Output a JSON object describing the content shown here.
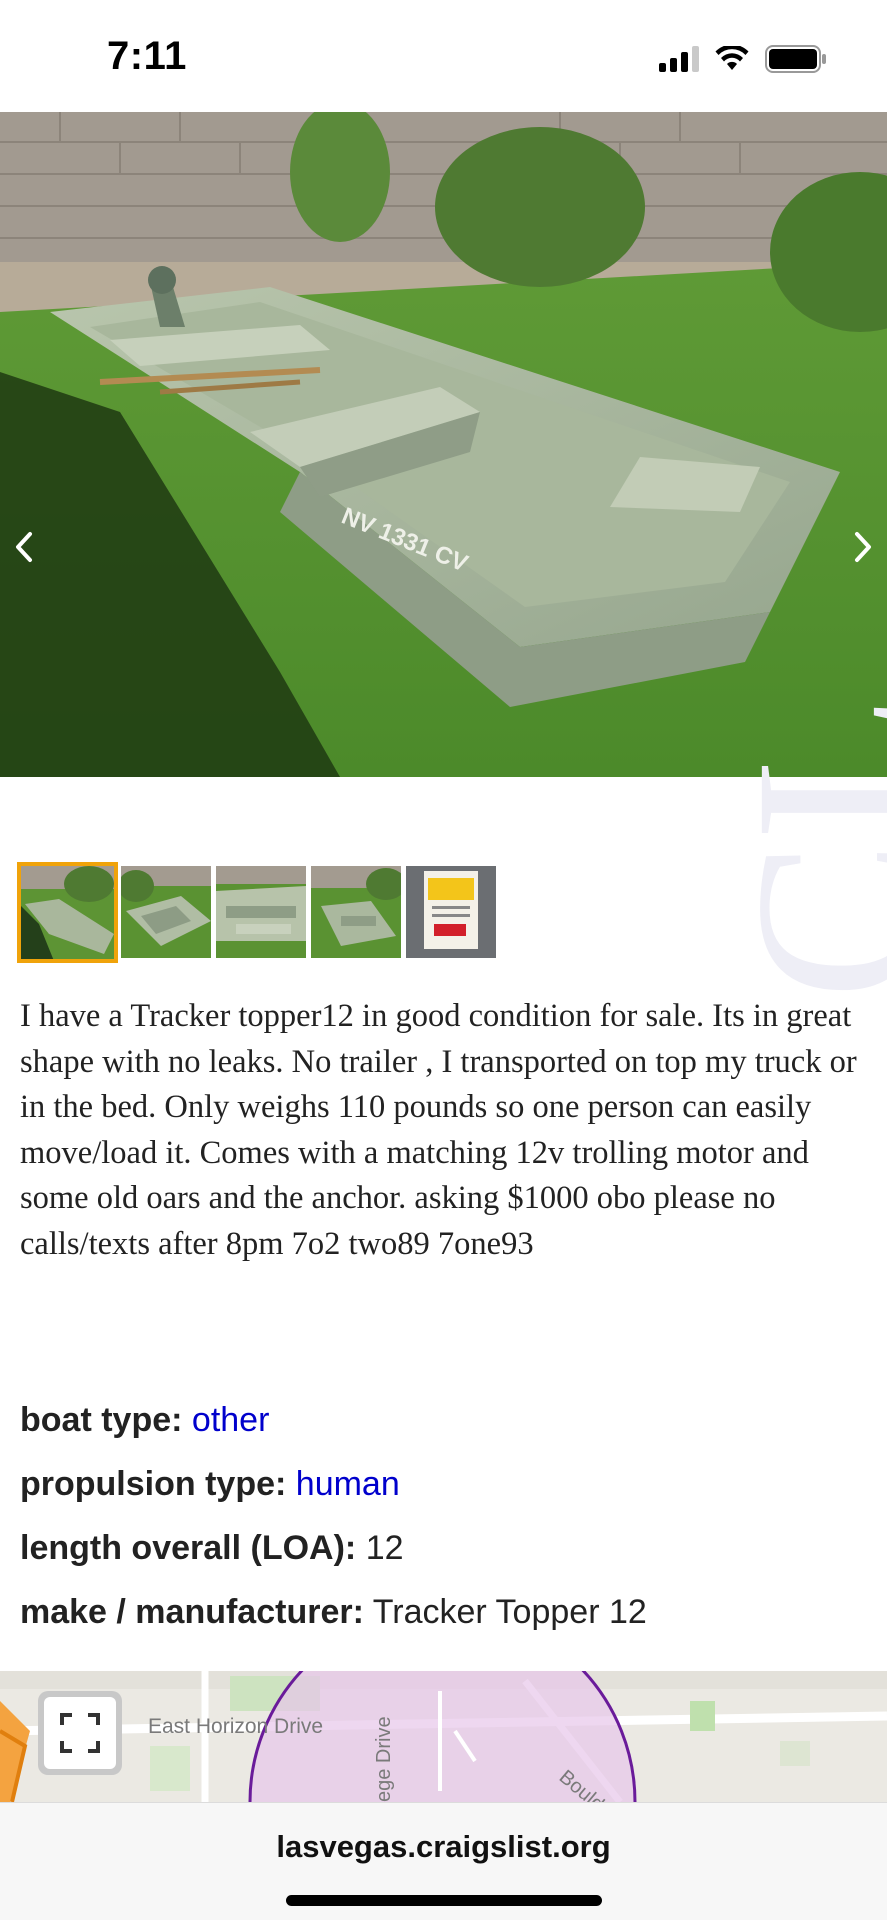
{
  "status_bar": {
    "time": "7:11",
    "icons": [
      "cellular-signal-icon",
      "wifi-icon",
      "battery-icon"
    ]
  },
  "gallery": {
    "main_image": "aluminum-jon-boat-on-grass",
    "prev_label": "‹",
    "next_label": "›",
    "thumbnails": [
      {
        "name": "boat-on-grass-1",
        "selected": true
      },
      {
        "name": "boat-on-grass-2",
        "selected": false
      },
      {
        "name": "boat-interior",
        "selected": false
      },
      {
        "name": "boat-on-grass-3",
        "selected": false
      },
      {
        "name": "registration-sign",
        "selected": false
      }
    ],
    "watermark": "CL"
  },
  "posting": {
    "description": "I have a Tracker topper12 in good condition for sale. Its in great shape with no leaks. No trailer , I transported on top my truck or in the bed. Only weighs 110 pounds so one person can easily move/load it. Comes with a matching 12v trolling motor and some old oars and the anchor. asking $1000 obo please no calls/texts after 8pm 7o2 two89 7one93",
    "attributes": [
      {
        "label": "boat type:",
        "value": "other",
        "link": true
      },
      {
        "label": "propulsion type:",
        "value": "human",
        "link": true
      },
      {
        "label": "length overall (LOA):",
        "value": "12",
        "link": false
      },
      {
        "label": "make / manufacturer:",
        "value": "Tracker Topper 12",
        "link": false
      }
    ]
  },
  "map": {
    "street_labels": [
      "East Horizon Drive",
      "ege Drive",
      "Bould"
    ]
  },
  "browser": {
    "url": "lasvegas.craigslist.org"
  },
  "colors": {
    "link": "#0000cc",
    "thumb_selected": "#f0a30a",
    "map_circle": "#6a1b9a"
  }
}
